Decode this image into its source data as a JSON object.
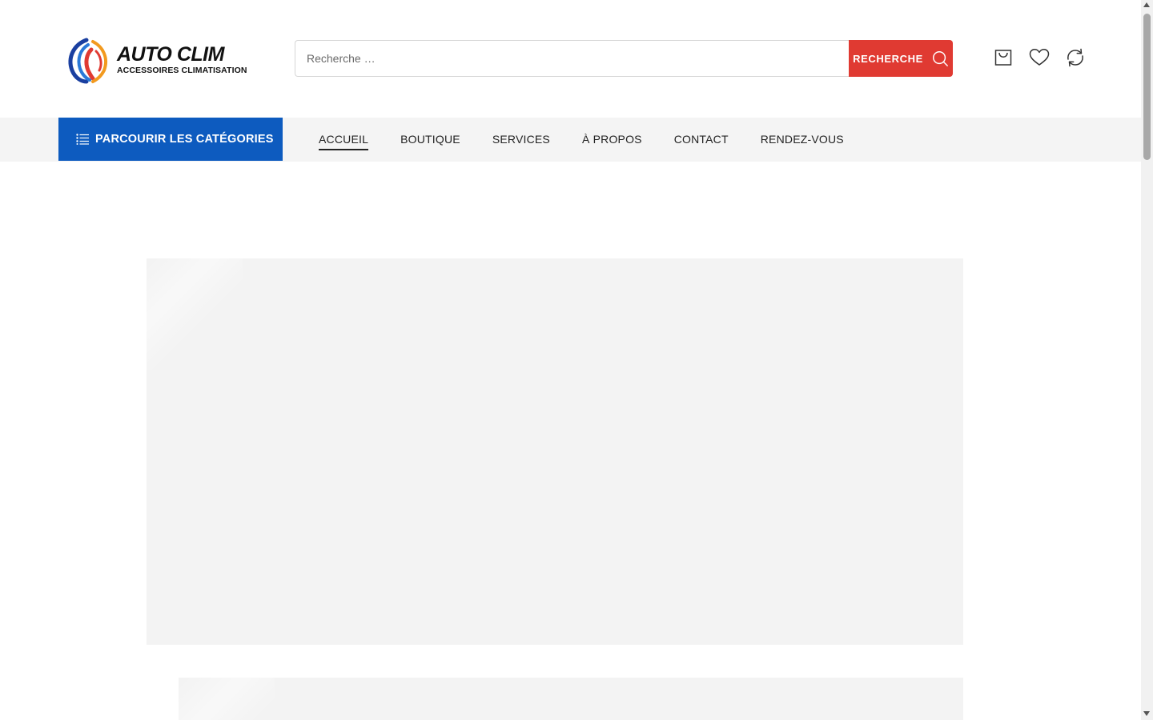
{
  "brand": {
    "title": "AUTO CLIM",
    "subtitle": "ACCESSOIRES CLIMATISATION",
    "colors": {
      "blue": "#1a3fa0",
      "red": "#e03a32",
      "orange": "#f29a1f"
    }
  },
  "search": {
    "placeholder": "Recherche …",
    "button_label": "RECHERCHE",
    "button_icon": "search-icon",
    "button_color": "#e03a32"
  },
  "header_icons": [
    "cart-icon",
    "heart-icon",
    "compare-icon"
  ],
  "nav": {
    "categories_label": "PARCOURIR LES CATÉGORIES",
    "categories_icon": "list-icon",
    "categories_color": "#0d5bbf",
    "items": [
      {
        "label": "ACCUEIL",
        "active": true
      },
      {
        "label": "BOUTIQUE",
        "active": false
      },
      {
        "label": "SERVICES",
        "active": false
      },
      {
        "label": "À PROPOS",
        "active": false
      },
      {
        "label": "CONTACT",
        "active": false
      },
      {
        "label": "RENDEZ-VOUS",
        "active": false
      }
    ]
  }
}
